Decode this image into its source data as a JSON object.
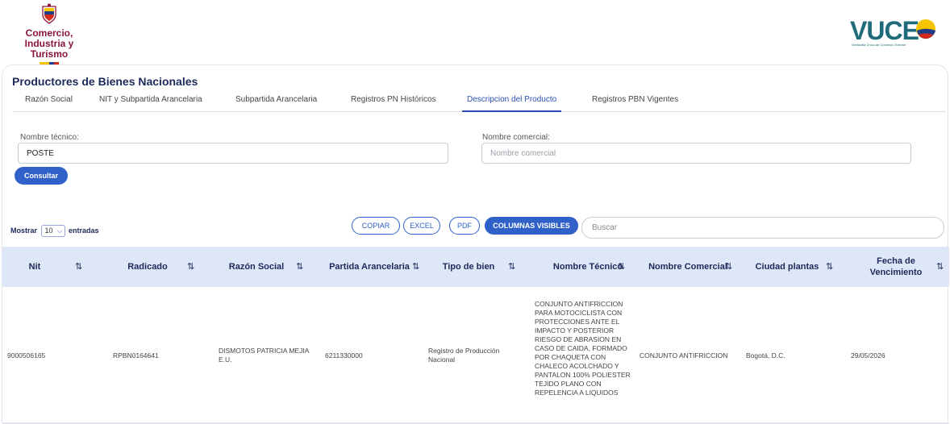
{
  "header": {
    "ministry_line1": "Comercio,",
    "ministry_line2": "Industria y Turismo",
    "vuce_word": "VUCE",
    "vuce_sub": "Ventanilla Única de Comercio Exterior"
  },
  "page": {
    "title": "Productores de Bienes Nacionales",
    "tabs": [
      {
        "label": "Razón Social"
      },
      {
        "label": "NIT y Subpartida Arancelaria"
      },
      {
        "label": "Subpartida Arancelaria"
      },
      {
        "label": "Registros PN Históricos"
      },
      {
        "label": "Descripcion del Producto",
        "active": true
      },
      {
        "label": "Registros PBN Vigentes"
      }
    ]
  },
  "form": {
    "tech_label": "Nombre técnico:",
    "tech_value": "POSTE",
    "comm_label": "Nombre comercial:",
    "comm_placeholder": "Nombre comercial",
    "consultar": "Consultar"
  },
  "table_controls": {
    "show_prefix": "Mostrar",
    "show_value": "10",
    "show_suffix": "entradas",
    "copy": "COPIAR",
    "excel": "EXCEL",
    "pdf": "PDF",
    "columns": "COLUMNAS VISIBLES",
    "search_placeholder": "Buscar"
  },
  "table": {
    "headers": [
      "Nit",
      "Radicado",
      "Razón Social",
      "Partida Arancelaria",
      "Tipo de bien",
      "Nombre Técnico",
      "Nombre Comercial",
      "Ciudad plantas",
      "Fecha de Vencimiento"
    ],
    "sort_glyph": "⇅",
    "rows": [
      {
        "nit": "9000506165",
        "radicado": "RPBN0164641",
        "razon": "DISMOTOS PATRICIA MEJIA E.U.",
        "partida": "6211330000",
        "tipo": "Registro de Producción Nacional",
        "tecnico": "CONJUNTO ANTIFRICCION PARA MOTOCICLISTA CON PROTECCIONES ANTE EL IMPACTO Y POSTERIOR RIESGO DE ABRASION EN CASO DE CAIDA, FORMADO POR CHAQUETA CON CHALECO ACOLCHADO Y PANTALON 100% POLIESTER TEJIDO PLANO CON REPELENCIA A LIQUIDOS",
        "comercial": "CONJUNTO ANTIFRICCION",
        "ciudad": "Bogotá, D.C.",
        "fecha": "29/05/2026"
      }
    ]
  },
  "colors": {
    "accent": "#2f61c9",
    "header_bg": "#dde7f7",
    "title": "#1c2a5a",
    "ministry": "#8b1538",
    "vuce": "#1f6b7a"
  }
}
